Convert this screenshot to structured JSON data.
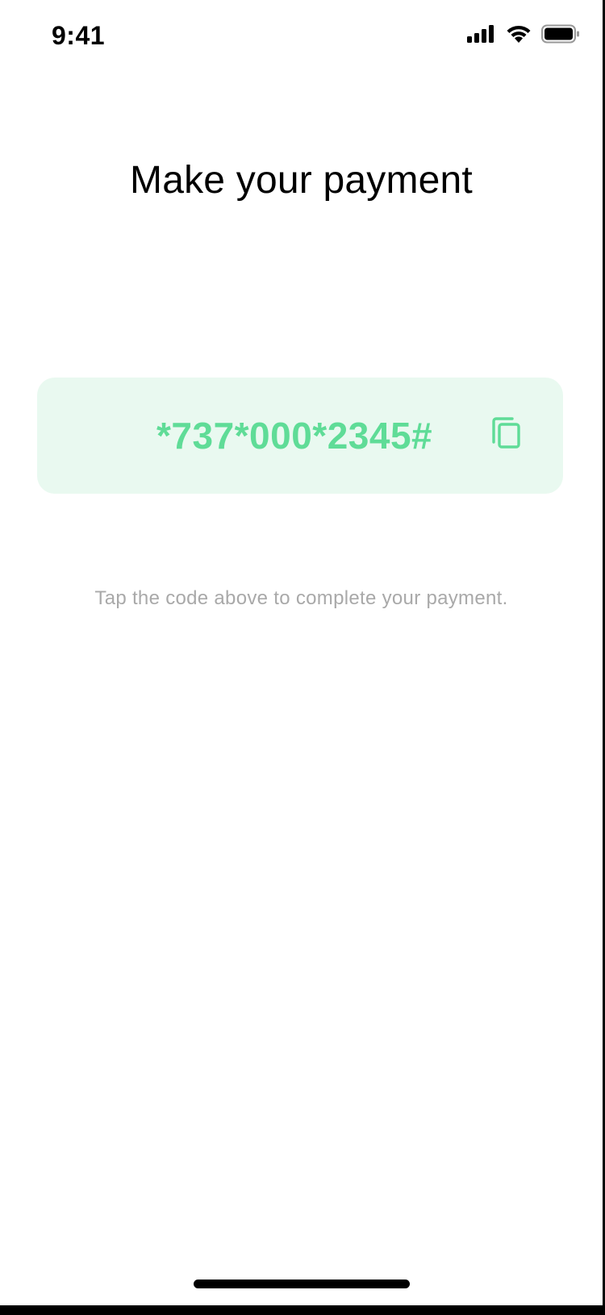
{
  "status_bar": {
    "time": "9:41",
    "icons": [
      "signal-icon",
      "wifi-icon",
      "battery-icon"
    ]
  },
  "page": {
    "title": "Make your payment"
  },
  "payment_code": {
    "code": "*737*000*2345#",
    "copy_icon": "copy-icon"
  },
  "instruction": {
    "text": "Tap the code above to complete your payment."
  },
  "colors": {
    "accent": "#5fdc97",
    "card_background": "#e9f9f0",
    "muted_text": "#a9a9a9",
    "title_text": "#000000"
  }
}
